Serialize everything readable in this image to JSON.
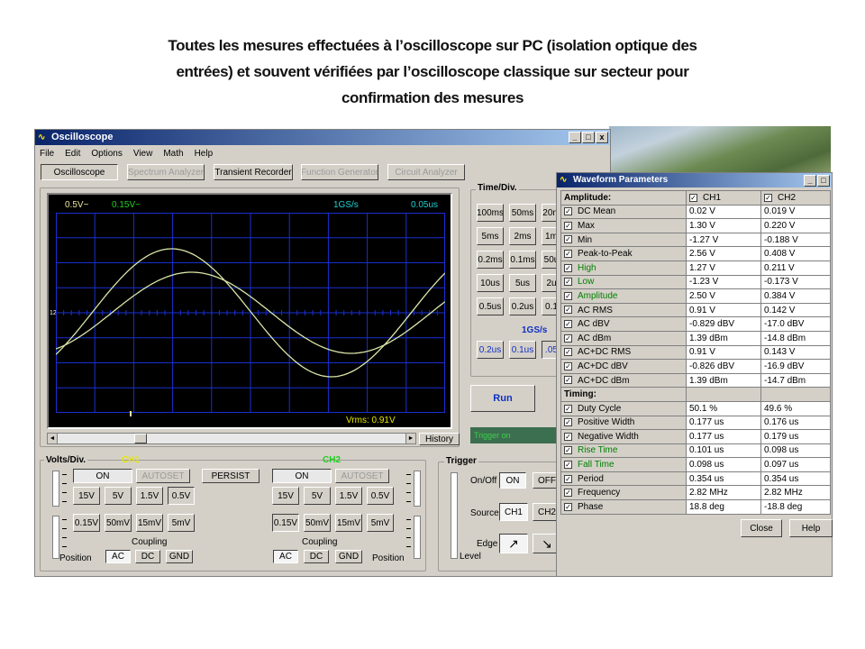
{
  "slide_title": {
    "line1": "Toutes les mesures effectuées à l’oscilloscope sur PC (isolation optique des",
    "line2": "entrées) et souvent vérifiées par l’oscilloscope classique sur secteur pour",
    "line3": "confirmation des mesures"
  },
  "window": {
    "title": "Oscilloscope",
    "controls": [
      "_",
      "□",
      "x"
    ],
    "menu": [
      "File",
      "Edit",
      "Options",
      "View",
      "Math",
      "Help"
    ],
    "tabs": [
      "Oscilloscope",
      "Spectrum Analyzer",
      "Transient Recorder",
      "Function Generator",
      "Circuit Analyzer"
    ]
  },
  "screen": {
    "ch1_scale": "0.5V~",
    "ch2_scale": "0.15V~",
    "sample_rate": "1GS/s",
    "timebase": "0.05us",
    "marker": "12",
    "readout": "Vrms: 0.91V",
    "history_label": "History"
  },
  "time_div": {
    "label": "Time/Div.",
    "rows": [
      [
        "100ms",
        "50ms",
        "20m"
      ],
      [
        "5ms",
        "2ms",
        "1m"
      ],
      [
        "0.2ms",
        "0.1ms",
        "50u"
      ],
      [
        "10us",
        "5us",
        "2u"
      ],
      [
        "0.5us",
        "0.2us",
        "0.1"
      ]
    ],
    "rate": "1GS/s",
    "fast": [
      "0.2us",
      "0.1us",
      ".05"
    ],
    "run_label": "Run",
    "trigger_status": "Trigger on"
  },
  "volts_div": {
    "label": "Volts/Div.",
    "ch1_label": "CH1",
    "ch2_label": "CH2",
    "on_label": "ON",
    "autoset_label": "AUTOSET",
    "persist_label": "PERSIST",
    "row1": [
      "15V",
      "5V",
      "1.5V",
      "0.5V"
    ],
    "row2": [
      "0.15V",
      "50mV",
      "15mV",
      "5mV"
    ],
    "coupling_label": "Coupling",
    "coupling": [
      "AC",
      "DC",
      "GND"
    ],
    "position_label": "Position"
  },
  "trigger": {
    "label": "Trigger",
    "onoff_label": "On/Off",
    "on_btn": "ON",
    "off_btn": "OFF",
    "source_label": "Source",
    "source_ch1": "CH1",
    "source_ch2": "CH2",
    "edge_label": "Edge",
    "level_label": "Level"
  },
  "waveform_params": {
    "title": "Waveform Parameters",
    "controls": [
      "_",
      "□"
    ],
    "amplitude_header": "Amplitude:",
    "ch1_header": "CH1",
    "ch2_header": "CH2",
    "amplitude_rows": [
      {
        "name": "DC  Mean",
        "ch1": "0.02 V",
        "ch2": "0.019 V",
        "green": false
      },
      {
        "name": "Max",
        "ch1": "1.30 V",
        "ch2": "0.220 V",
        "green": false
      },
      {
        "name": "Min",
        "ch1": "-1.27 V",
        "ch2": "-0.188 V",
        "green": false
      },
      {
        "name": "Peak-to-Peak",
        "ch1": "2.56 V",
        "ch2": "0.408 V",
        "green": false
      },
      {
        "name": "High",
        "ch1": "1.27 V",
        "ch2": "0.211 V",
        "green": true
      },
      {
        "name": "Low",
        "ch1": "-1.23 V",
        "ch2": "-0.173 V",
        "green": true
      },
      {
        "name": "Amplitude",
        "ch1": "2.50 V",
        "ch2": "0.384 V",
        "green": true
      },
      {
        "name": "AC RMS",
        "ch1": "0.91 V",
        "ch2": "0.142 V",
        "green": false
      },
      {
        "name": "AC dBV",
        "ch1": "-0.829 dBV",
        "ch2": "-17.0 dBV",
        "green": false
      },
      {
        "name": "AC dBm",
        "ch1": "1.39 dBm",
        "ch2": "-14.8 dBm",
        "green": false
      },
      {
        "name": "AC+DC RMS",
        "ch1": "0.91 V",
        "ch2": "0.143 V",
        "green": false
      },
      {
        "name": "AC+DC dBV",
        "ch1": "-0.826 dBV",
        "ch2": "-16.9 dBV",
        "green": false
      },
      {
        "name": "AC+DC dBm",
        "ch1": "1.39 dBm",
        "ch2": "-14.7 dBm",
        "green": false
      }
    ],
    "timing_header": "Timing:",
    "timing_rows": [
      {
        "name": "Duty Cycle",
        "ch1": "50.1 %",
        "ch2": "49.6 %",
        "green": false
      },
      {
        "name": "Positive Width",
        "ch1": "0.177 us",
        "ch2": "0.176 us",
        "green": false
      },
      {
        "name": "Negative Width",
        "ch1": "0.177 us",
        "ch2": "0.179 us",
        "green": false
      },
      {
        "name": "Rise Time",
        "ch1": "0.101 us",
        "ch2": "0.098 us",
        "green": true
      },
      {
        "name": "Fall Time",
        "ch1": "0.098 us",
        "ch2": "0.097 us",
        "green": true
      },
      {
        "name": "Period",
        "ch1": "0.354 us",
        "ch2": "0.354 us",
        "green": false
      },
      {
        "name": "Frequency",
        "ch1": "2.82 MHz",
        "ch2": "2.82 MHz",
        "green": false
      },
      {
        "name": "Phase",
        "ch1": "18.8 deg",
        "ch2": "-18.8 deg",
        "green": false
      }
    ],
    "close_label": "Close",
    "help_label": "Help"
  },
  "colors": {
    "grid": "#1a2fd0",
    "trace": "#d8e6a8",
    "ch1_label": "#e8e800",
    "ch2_label": "#20d020",
    "accent_blue": "#1030c0"
  }
}
